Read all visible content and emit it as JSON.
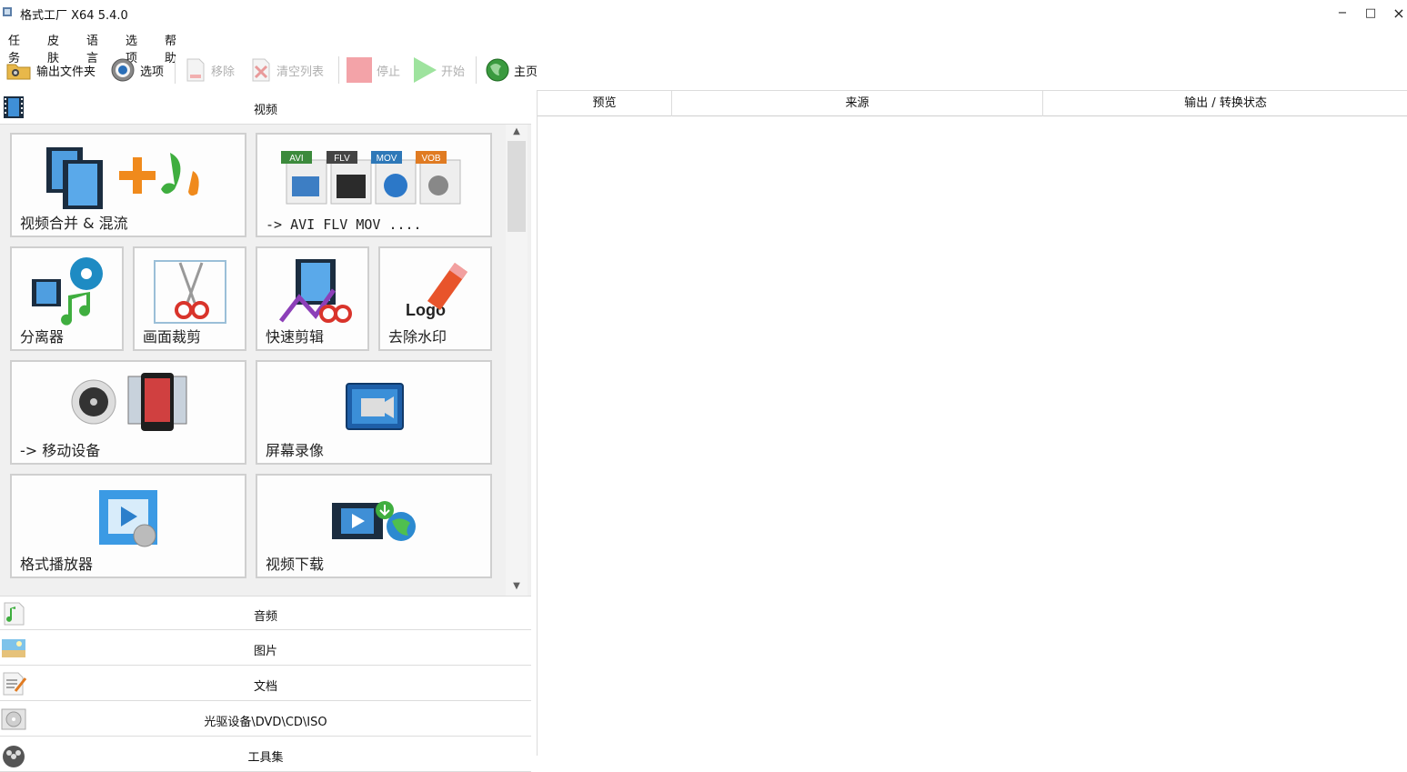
{
  "window": {
    "title": "格式工厂 X64 5.4.0",
    "minimize": "−",
    "maximize": "□",
    "close": "×"
  },
  "menu": [
    "任务",
    "皮肤",
    "语言",
    "选项",
    "帮助"
  ],
  "toolbar": {
    "output_folder": "输出文件夹",
    "options": "选项",
    "remove": "移除",
    "clear_list": "清空列表",
    "stop": "停止",
    "start": "开始",
    "home": "主页"
  },
  "categories": {
    "video": "视频",
    "audio": "音频",
    "image": "图片",
    "document": "文档",
    "disc": "光驱设备\\DVD\\CD\\ISO",
    "tools": "工具集"
  },
  "tiles": {
    "merge": "视频合并 & 混流",
    "formats": "-> AVI FLV MOV ....",
    "separator": "分离器",
    "crop": "画面裁剪",
    "quick_edit": "快速剪辑",
    "remove_watermark": "去除水印",
    "mobile": "-> 移动设备",
    "screen_record": "屏幕录像",
    "player": "格式播放器",
    "download": "视频下载"
  },
  "format_badges": [
    "AVI",
    "FLV",
    "MOV",
    "VOB"
  ],
  "logo_text": "Logo",
  "columns": {
    "preview": "预览",
    "source": "来源",
    "status": "输出 / 转换状态"
  }
}
